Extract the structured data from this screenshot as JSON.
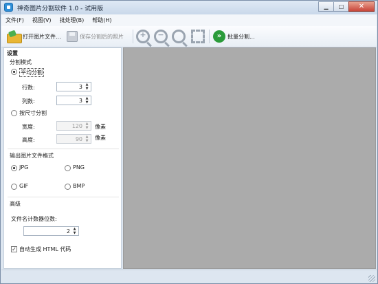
{
  "window": {
    "title": "神奇图片分割软件 1.0 - 试用版"
  },
  "menu": [
    "文件(F)",
    "视图(V)",
    "批处理(B)",
    "帮助(H)"
  ],
  "toolbar": {
    "open_label": "打开图片文件...",
    "save_label": "保存分割后的照片",
    "batch_label": "批量分割..."
  },
  "settings": {
    "header": "设置",
    "split_mode": {
      "title": "分割模式",
      "even_label": "平均分割",
      "rows_label": "行数:",
      "rows_value": "3",
      "cols_label": "列数:",
      "cols_value": "3",
      "size_label": "按尺寸分割",
      "width_label": "宽度:",
      "width_value": "120",
      "height_label": "高度:",
      "height_value": "90",
      "unit": "像素"
    },
    "output": {
      "title": "输出图片文件格式",
      "jpg": "JPG",
      "png": "PNG",
      "gif": "GIF",
      "bmp": "BMP"
    },
    "advanced": {
      "title": "高级",
      "digits_label": "文件名计数器位数:",
      "digits_value": "2",
      "html_label": "自动生成 HTML 代码"
    }
  }
}
